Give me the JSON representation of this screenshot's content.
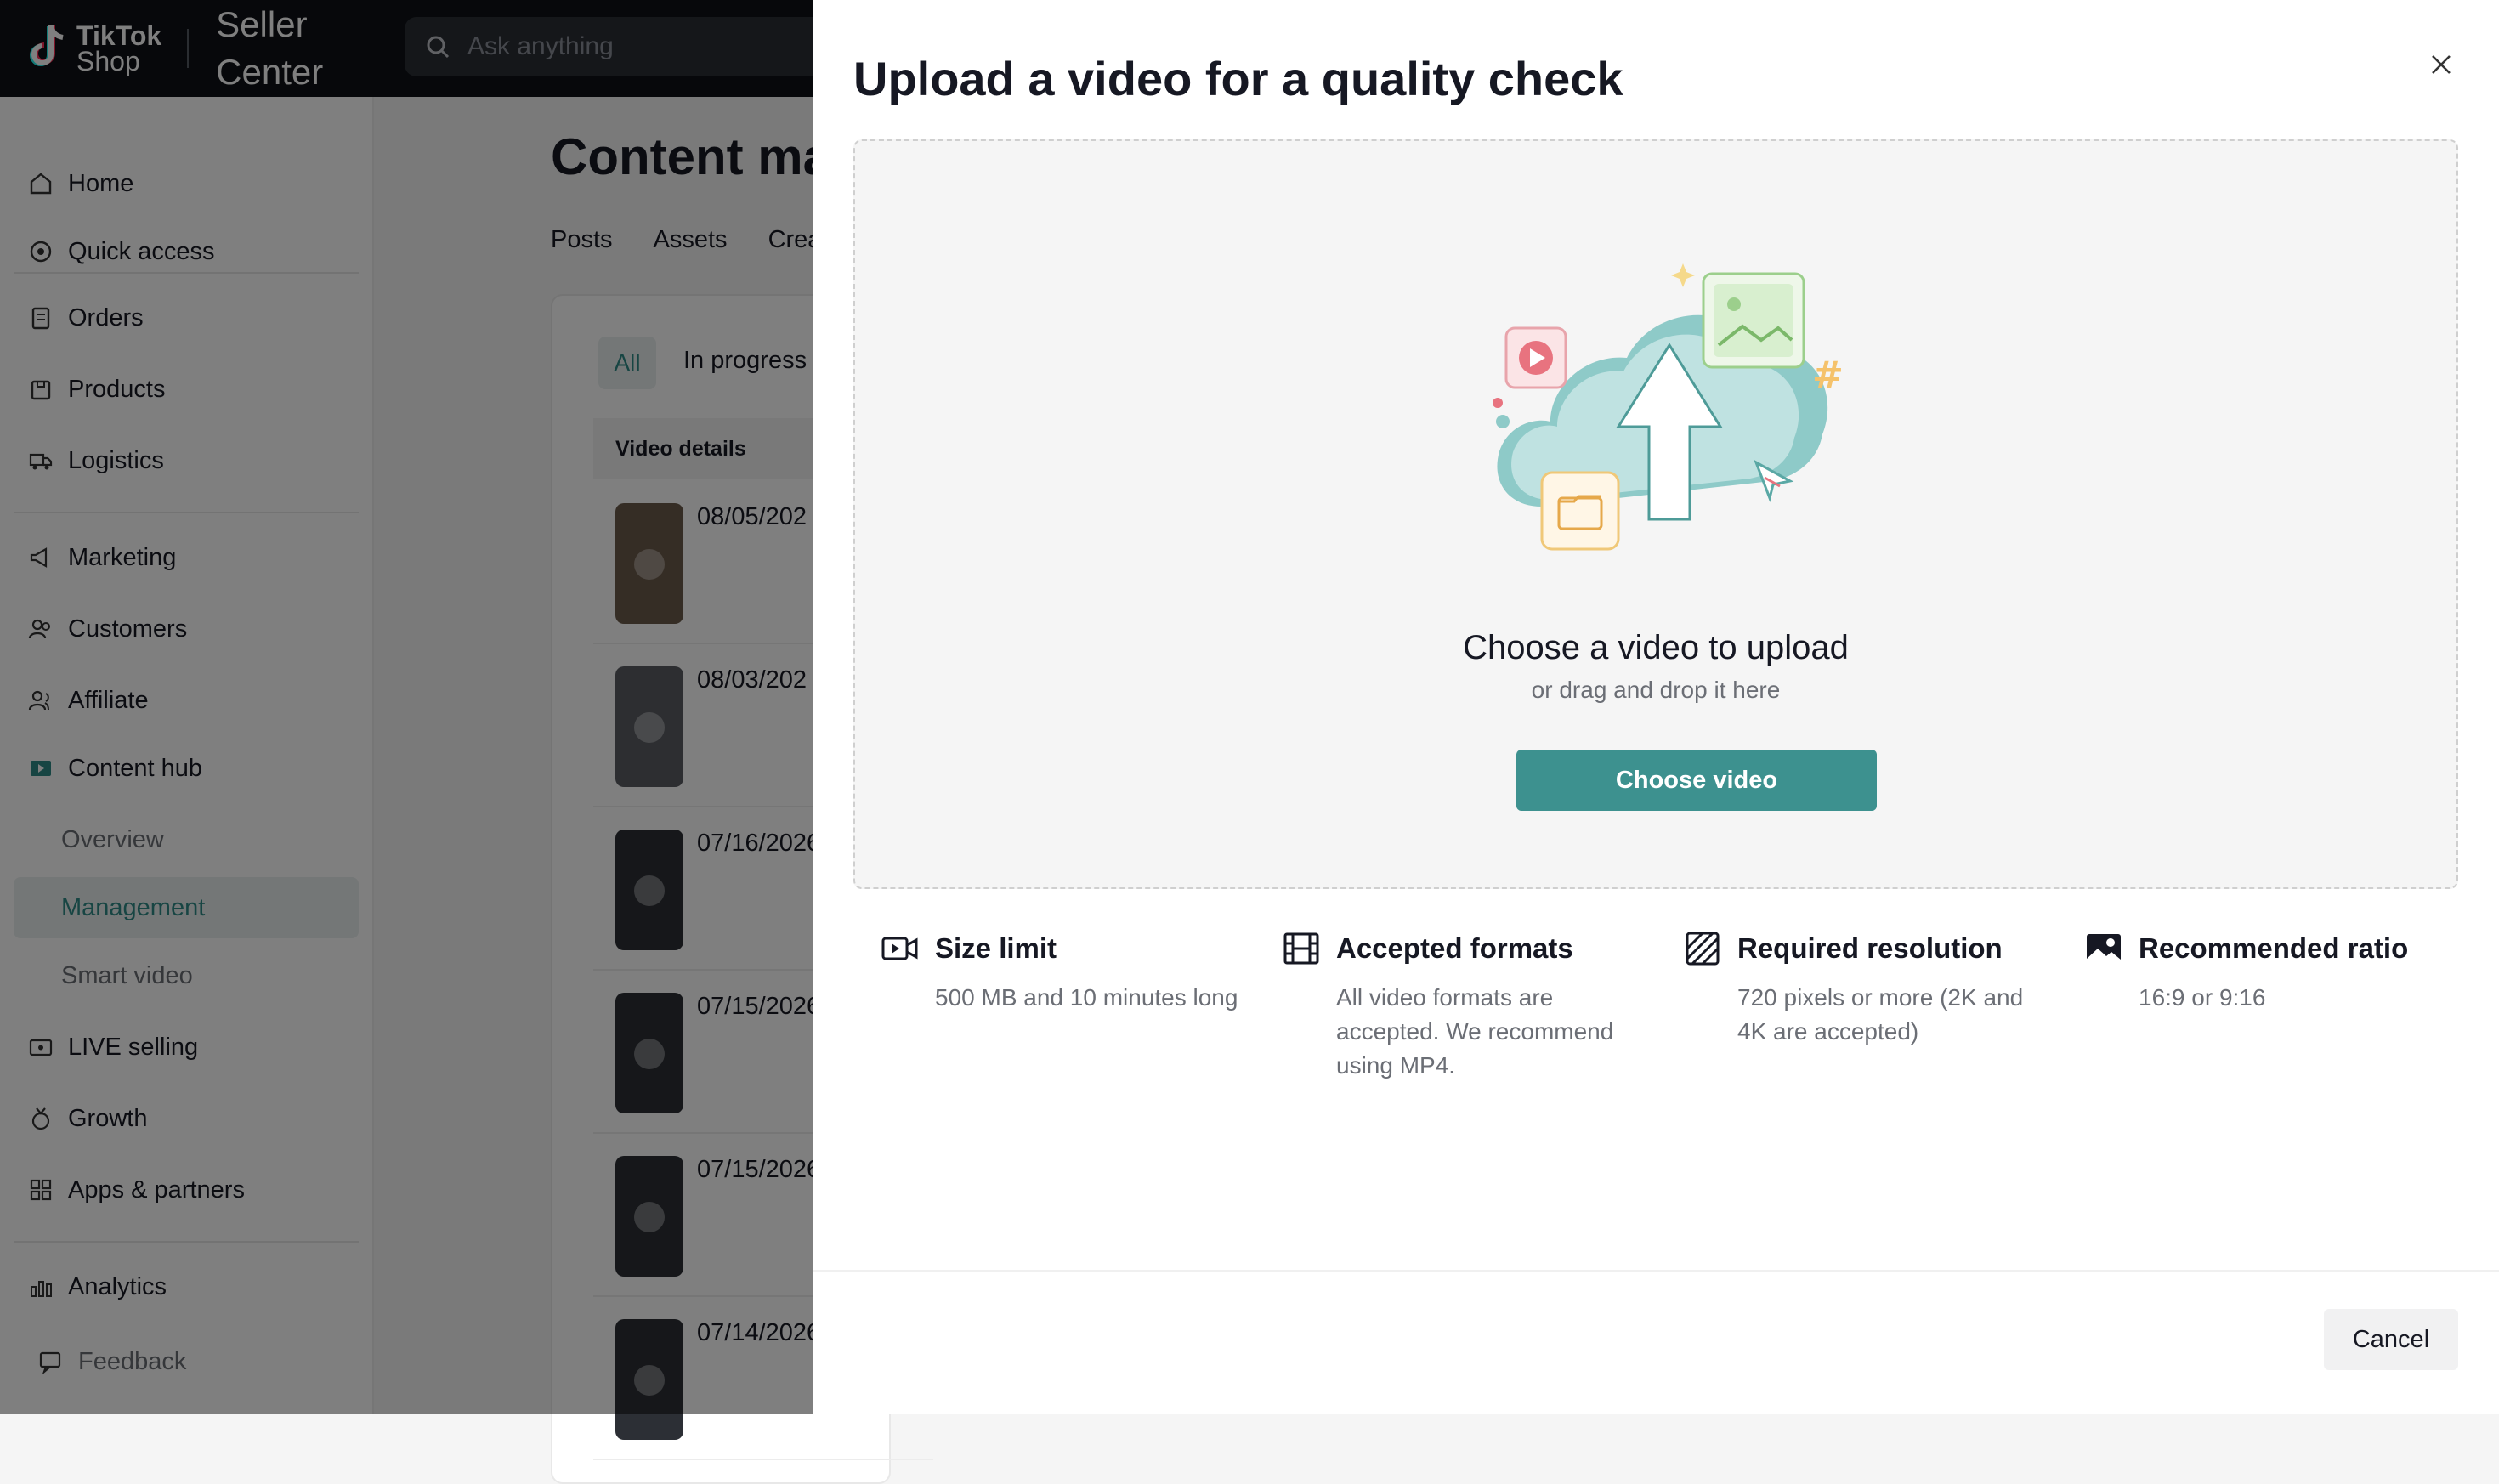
{
  "topbar": {
    "logo_line1": "TikTok",
    "logo_line2": "Shop",
    "seller_line1": "Seller",
    "seller_line2": "Center",
    "search_placeholder": "Ask anything"
  },
  "sidebar": {
    "items": [
      {
        "label": "Home",
        "icon": "home-icon"
      },
      {
        "label": "Quick access",
        "icon": "quick-access-icon"
      },
      {
        "label": "Orders",
        "icon": "orders-icon"
      },
      {
        "label": "Products",
        "icon": "products-icon"
      },
      {
        "label": "Logistics",
        "icon": "truck-icon"
      },
      {
        "label": "Marketing",
        "icon": "megaphone-icon"
      },
      {
        "label": "Customers",
        "icon": "customers-icon"
      },
      {
        "label": "Affiliate",
        "icon": "affiliate-icon"
      },
      {
        "label": "Content hub",
        "icon": "content-hub-icon"
      },
      {
        "label": "Overview"
      },
      {
        "label": "Management"
      },
      {
        "label": "Smart video"
      },
      {
        "label": "LIVE selling",
        "icon": "live-icon"
      },
      {
        "label": "Growth",
        "icon": "growth-icon"
      },
      {
        "label": "Apps & partners",
        "icon": "apps-icon"
      },
      {
        "label": "Analytics",
        "icon": "analytics-icon"
      },
      {
        "label": "Feedback",
        "icon": "feedback-icon"
      }
    ]
  },
  "main": {
    "title": "Content ma",
    "tabs": [
      "Posts",
      "Assets",
      "Crea"
    ],
    "filters": [
      "All",
      "In progress"
    ],
    "table_header": "Video details",
    "rows": [
      "08/05/202",
      "08/03/202",
      "07/16/2026",
      "07/15/2026",
      "07/15/2026",
      "07/14/2026"
    ]
  },
  "drawer": {
    "title": "Upload a video for a quality check",
    "dropzone_title": "Choose a video to upload",
    "dropzone_subtitle": "or drag and drop it here",
    "choose_button": "Choose video",
    "info": [
      {
        "title": "Size limit",
        "desc": "500 MB and 10 minutes long",
        "icon": "video-icon"
      },
      {
        "title": "Accepted formats",
        "desc": "All video formats are accepted. We recommend using MP4.",
        "icon": "film-icon"
      },
      {
        "title": "Required resolution",
        "desc": "720 pixels or more (2K and 4K are accepted)",
        "icon": "resolution-icon"
      },
      {
        "title": "Recommended ratio",
        "desc": "16:9 or 9:16",
        "icon": "ratio-icon"
      }
    ],
    "cancel_button": "Cancel"
  },
  "colors": {
    "accent": "#3d918f",
    "topbar": "#0e1116",
    "active_nav_bg": "#e8efef"
  }
}
